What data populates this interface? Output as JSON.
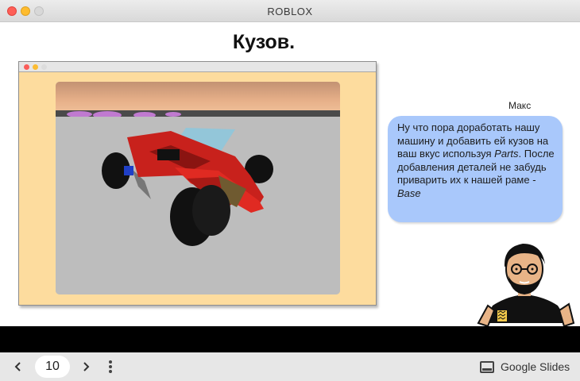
{
  "window": {
    "title": "ROBLOX"
  },
  "slide": {
    "title": "Кузов.",
    "speaker": "Макс",
    "bubble": {
      "part1": "Ну что пора доработать нашу машину и добавить ей кузов на ваш вкус используя ",
      "em1": "Parts",
      "part2": ". После добавления деталей не забудь приварить их к нашей раме - ",
      "em2": "Base"
    },
    "image_description": "roblox-car-screenshot"
  },
  "toolbar": {
    "page_number": "10",
    "app_label": "Google Slides"
  },
  "colors": {
    "bubble": "#a9c8fb",
    "frame": "#fddc9e",
    "car_body": "#c8211c"
  },
  "icons": [
    "chevron-left-icon",
    "chevron-right-icon",
    "more-vert-icon",
    "slides-icon"
  ]
}
